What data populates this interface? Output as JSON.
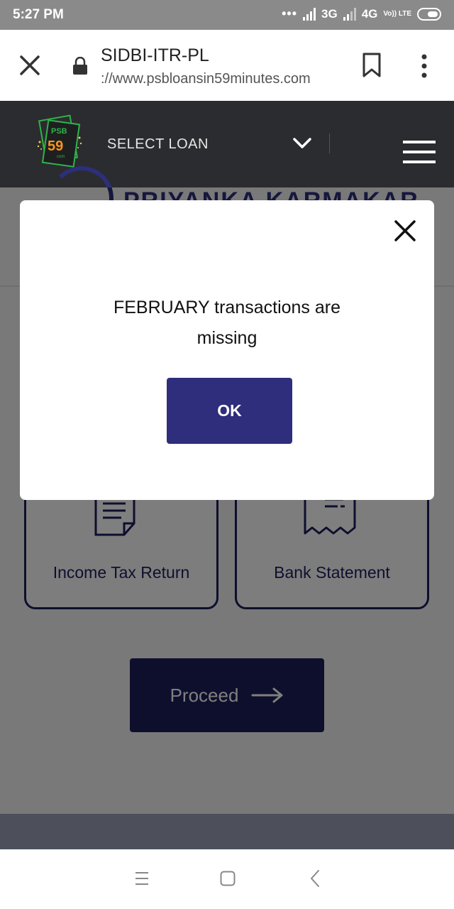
{
  "status_bar": {
    "time": "5:27 PM",
    "network_1": "3G",
    "network_2": "4G",
    "volte": "Vo)) LTE"
  },
  "browser": {
    "title": "SIDBI-ITR-PL",
    "url": "://www.psbloansin59minutes.com",
    "icons": [
      "close-icon",
      "lock-icon",
      "bookmark-icon",
      "overflow-menu-icon"
    ]
  },
  "site_header": {
    "logo_top": "PSB",
    "logo_number": "59",
    "logo_small": "com",
    "select_loan": "SELECT LOAN",
    "icons": [
      "chevron-down-icon",
      "hamburger-menu-icon"
    ]
  },
  "content": {
    "user_name": "PRIYANKA KARMAKAR",
    "cards": [
      {
        "label": "Income Tax Return",
        "icon": "document-icon"
      },
      {
        "label": "Bank Statement",
        "icon": "receipt-icon"
      }
    ],
    "proceed_label": "Proceed"
  },
  "modal": {
    "message": "FEBRUARY transactions are missing",
    "ok_label": "OK"
  },
  "colors": {
    "brand_navy": "#1d1f5a",
    "ok_button": "#2e2e7c",
    "header_bg": "#2b2c2f",
    "logo_green": "#2fb34a",
    "logo_orange": "#f7941d"
  }
}
